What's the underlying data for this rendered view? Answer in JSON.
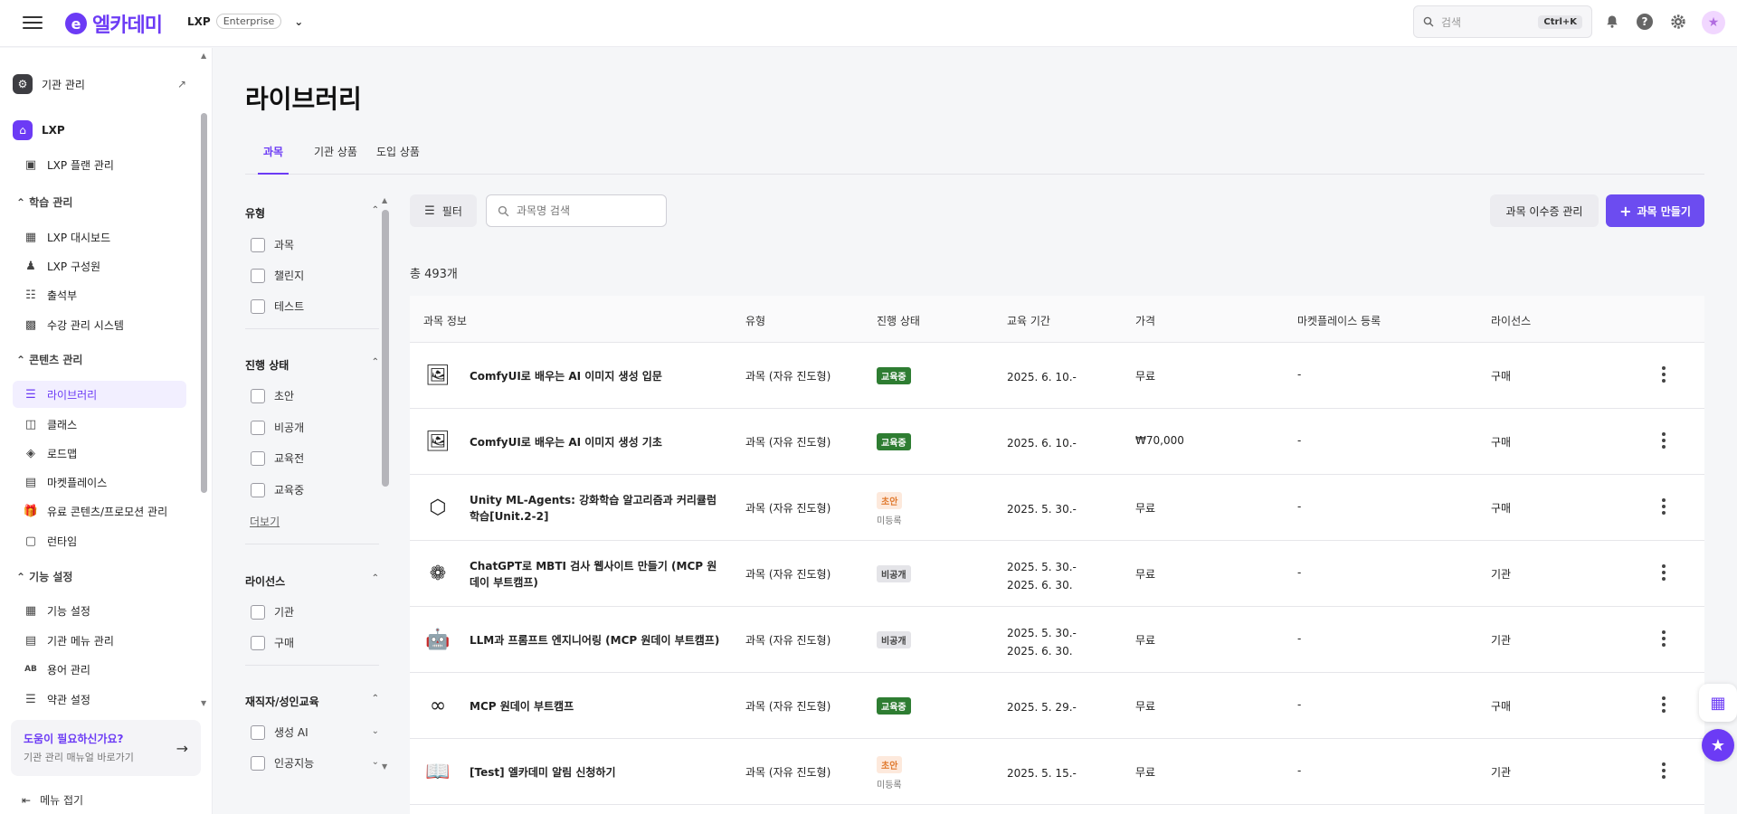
{
  "header": {
    "logo_mark": "e",
    "logo_text": "엘카데미",
    "product": "LXP",
    "edition": "Enterprise",
    "search_placeholder": "검색",
    "search_shortcut": "Ctrl+K"
  },
  "sidebar": {
    "org": "기관 관리",
    "lxp": "LXP",
    "plan": "LXP 플랜 관리",
    "section_learning": "학습 관리",
    "learning_items": [
      "LXP 대시보드",
      "LXP 구성원",
      "출석부",
      "수강 관리 시스템"
    ],
    "section_content": "콘텐츠 관리",
    "content_items": [
      "라이브러리",
      "클래스",
      "로드맵",
      "마켓플레이스",
      "유료 콘텐츠/프로모션 관리",
      "런타임"
    ],
    "section_feature": "기능 설정",
    "feature_items": [
      "기능 설정",
      "기관 메뉴 관리",
      "용어 관리",
      "약관 설정"
    ],
    "help_title": "도움이 필요하신가요?",
    "help_sub": "기관 관리 매뉴얼 바로가기",
    "collapse": "메뉴 접기"
  },
  "page": {
    "title": "라이브러리",
    "tabs": [
      "과목",
      "기관 상품",
      "도입 상품"
    ],
    "active_tab": "과목"
  },
  "filters": {
    "type_title": "유형",
    "type_options": [
      "과목",
      "챌린지",
      "테스트"
    ],
    "status_title": "진행 상태",
    "status_options": [
      "초안",
      "비공개",
      "교육전",
      "교육중"
    ],
    "more": "더보기",
    "license_title": "라이선스",
    "license_options": [
      "기관",
      "구매"
    ],
    "adult_title": "재직자/성인교육",
    "adult_options": [
      "생성 AI",
      "인공지능"
    ]
  },
  "toolbar": {
    "filter_label": "필터",
    "search_placeholder": "과목명 검색",
    "manage_label": "과목 이수증 관리",
    "create_label": "과목 만들기"
  },
  "total": "총 493개",
  "table": {
    "columns": [
      "과목 정보",
      "유형",
      "진행 상태",
      "교육 기간",
      "가격",
      "마켓플레이스 등록",
      "라이선스"
    ],
    "rows": [
      {
        "icon": "comfyui-thumb",
        "name": "ComfyUI로 배우는 AI 이미지 생성 입문",
        "type": "과목 (자유 진도형)",
        "status": "교육중",
        "status_kind": "on",
        "sub": "",
        "period1": "2025. 6. 10.-",
        "period2": "",
        "price": "무료",
        "market": "-",
        "license": "구매"
      },
      {
        "icon": "comfyui-thumb",
        "name": "ComfyUI로 배우는 AI 이미지 생성 기초",
        "type": "과목 (자유 진도형)",
        "status": "교육중",
        "status_kind": "on",
        "sub": "",
        "period1": "2025. 6. 10.-",
        "period2": "",
        "price": "₩70,000",
        "market": "-",
        "license": "구매"
      },
      {
        "icon": "unity-thumb",
        "name": "Unity ML-Agents: 강화학습 알고리즘과 커리큘럼 학습[Unit.2-2]",
        "type": "과목 (자유 진도형)",
        "status": "초안",
        "status_kind": "draft",
        "sub": "미등록",
        "period1": "2025. 5. 30.-",
        "period2": "",
        "price": "무료",
        "market": "-",
        "license": "구매"
      },
      {
        "icon": "chatgpt-mbti-thumb",
        "name": "ChatGPT로 MBTI 검사 웹사이트 만들기 (MCP 원데이 부트캠프)",
        "type": "과목 (자유 진도형)",
        "status": "비공개",
        "status_kind": "private",
        "sub": "",
        "period1": "2025. 5. 30.-",
        "period2": "2025. 6. 30.",
        "price": "무료",
        "market": "-",
        "license": "기관"
      },
      {
        "icon": "llm-thumb",
        "name": "LLM과 프롬프트 엔지니어링 (MCP 원데이 부트캠프)",
        "type": "과목 (자유 진도형)",
        "status": "비공개",
        "status_kind": "private",
        "sub": "",
        "period1": "2025. 5. 30.-",
        "period2": "2025. 6. 30.",
        "price": "무료",
        "market": "-",
        "license": "기관"
      },
      {
        "icon": "mcp-thumb",
        "name": "MCP 원데이 부트캠프",
        "type": "과목 (자유 진도형)",
        "status": "교육중",
        "status_kind": "on",
        "sub": "",
        "period1": "2025. 5. 29.-",
        "period2": "",
        "price": "무료",
        "market": "-",
        "license": "구매"
      },
      {
        "icon": "book-thumb",
        "name": "[Test] 엘카데미 알림 신청하기",
        "type": "과목 (자유 진도형)",
        "status": "초안",
        "status_kind": "draft",
        "sub": "미등록",
        "period1": "2025. 5. 15.-",
        "period2": "",
        "price": "무료",
        "market": "-",
        "license": "기관"
      }
    ]
  },
  "colors": {
    "accent": "#6c3bf5",
    "status_on": "#2e7d32",
    "status_draft": "#e07a2f"
  }
}
